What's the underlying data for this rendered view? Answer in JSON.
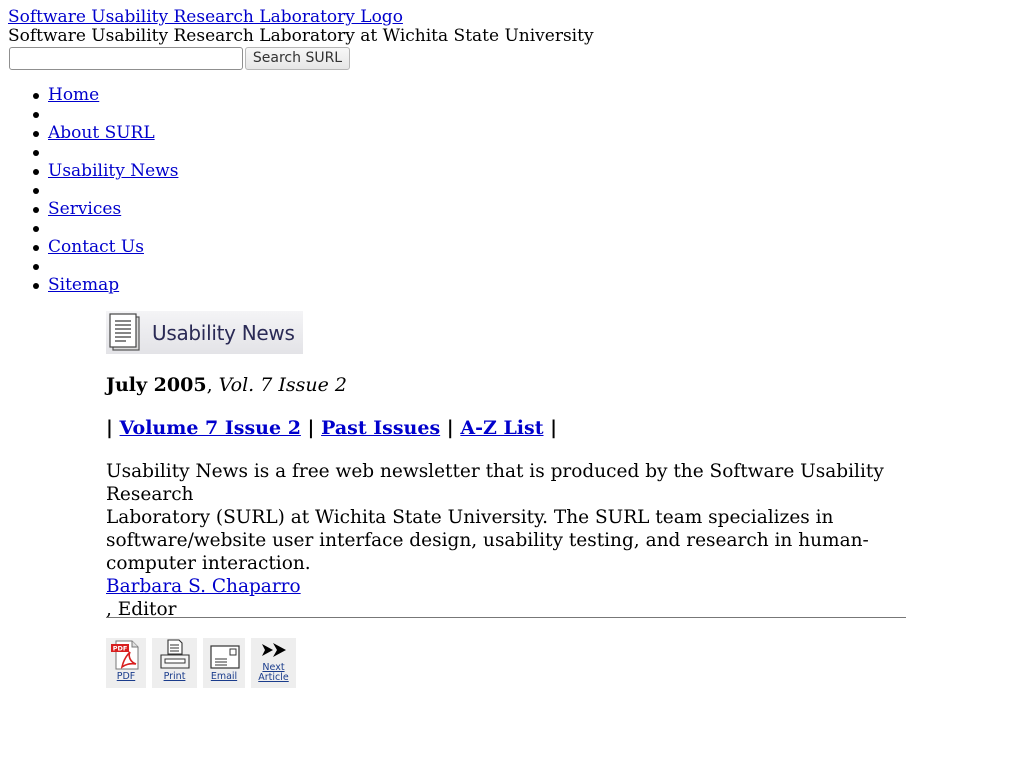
{
  "header": {
    "logo_alt": "Software Usability Research Laboratory Logo",
    "site_name": "Software Usability Research Laboratory at Wichita State University"
  },
  "search": {
    "value": "",
    "placeholder": "",
    "button_label": "Search SURL"
  },
  "nav": {
    "items": [
      {
        "label": "Home"
      },
      {
        "label": ""
      },
      {
        "label": "About SURL"
      },
      {
        "label": ""
      },
      {
        "label": "Usability News"
      },
      {
        "label": ""
      },
      {
        "label": "Services"
      },
      {
        "label": ""
      },
      {
        "label": "Contact Us"
      },
      {
        "label": ""
      },
      {
        "label": "Sitemap"
      }
    ]
  },
  "banner": {
    "title": "Usability News",
    "icon": "document-icon"
  },
  "issue": {
    "date": "July 2005",
    "separator": ", ",
    "volume": "Vol. 7 Issue 2"
  },
  "issue_nav": {
    "sep": "|",
    "links": [
      "Volume 7 Issue 2",
      "Past Issues",
      "A-Z List"
    ]
  },
  "description": {
    "line1": "Usability News is a free web newsletter that is produced by the Software Usability Research",
    "line2": "Laboratory (SURL) at Wichita State University. The SURL team specializes in software/website user interface design, usability testing, and research in human-computer interaction.",
    "editor_name": "Barbara S. Chaparro",
    "editor_suffix": ", Editor"
  },
  "tools": [
    {
      "label": "PDF",
      "icon": "pdf-icon"
    },
    {
      "label": "Print",
      "icon": "printer-icon"
    },
    {
      "label": "Email",
      "icon": "email-icon"
    },
    {
      "label": "Next",
      "label2": "Article",
      "icon": "next-arrow-icon"
    }
  ],
  "colors": {
    "link": "#0000cc",
    "tool_label": "#1a3c8c",
    "banner_text": "#2a2a55"
  }
}
